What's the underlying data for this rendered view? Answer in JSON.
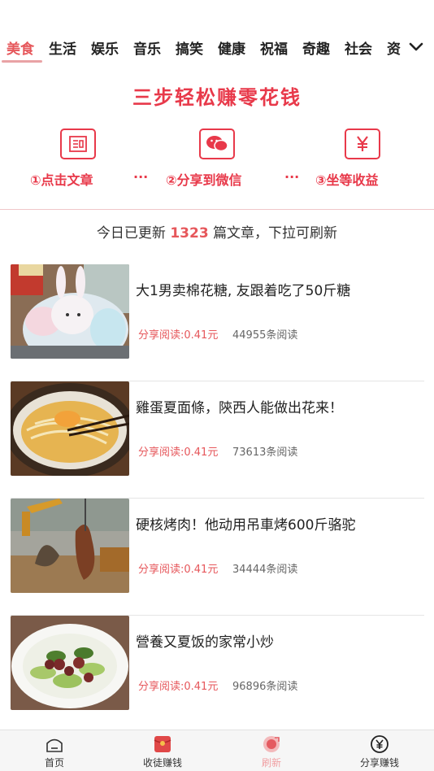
{
  "tabs": {
    "items": [
      {
        "label": "美食",
        "active": true
      },
      {
        "label": "生活"
      },
      {
        "label": "娱乐"
      },
      {
        "label": "音乐"
      },
      {
        "label": "搞笑"
      },
      {
        "label": "健康"
      },
      {
        "label": "祝福"
      },
      {
        "label": "奇趣"
      },
      {
        "label": "社会"
      },
      {
        "label": "资"
      }
    ],
    "more_icon": "chevron-down-icon"
  },
  "banner": {
    "title": "三步轻松赚零花钱",
    "steps": [
      {
        "label": "①点击文章",
        "icon": "article-icon"
      },
      {
        "label": "②分享到微信",
        "icon": "wechat-icon"
      },
      {
        "label": "③坐等收益",
        "icon": "yuan-icon"
      }
    ],
    "separator": "···",
    "accent_color": "#e8394a"
  },
  "info": {
    "prefix": "今日已更新",
    "count": "1323",
    "suffix": "篇文章，下拉可刷新"
  },
  "articles": [
    {
      "title": "大1男卖棉花糖, 友跟着吃了50斤糖",
      "reward": "分享阅读:0.41元",
      "reads": "44955条阅读"
    },
    {
      "title": "雞蛋夏面條，陝西人能做出花来！",
      "reward": "分享阅读:0.41元",
      "reads": "73613条阅读"
    },
    {
      "title": "硬核烤肉！他动用吊車烤600斤骆驼",
      "reward": "分享阅读:0.41元",
      "reads": "34444条阅读"
    },
    {
      "title": "營養又夏饭的家常小炒",
      "reward": "分享阅读:0.41元",
      "reads": "96896条阅读"
    }
  ],
  "bottom_nav": [
    {
      "label": "首页",
      "icon": "home-icon"
    },
    {
      "label": "收徒赚钱",
      "icon": "red-envelope-icon"
    },
    {
      "label": "刷新",
      "icon": "refresh-icon"
    },
    {
      "label": "分享赚钱",
      "icon": "yuan-circle-icon"
    }
  ],
  "colors": {
    "accent": "#e6575b",
    "banner_red": "#e8394a"
  }
}
